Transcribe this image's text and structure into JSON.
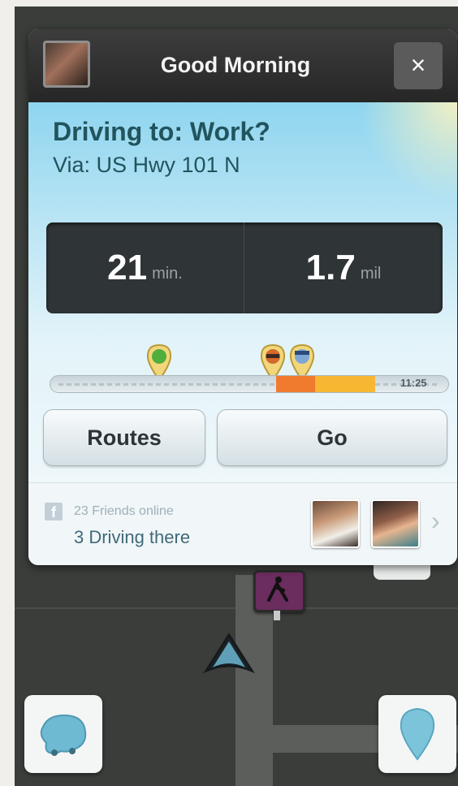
{
  "header": {
    "title": "Good Morning",
    "close_label": "×"
  },
  "destination": {
    "title": "Driving to: Work?",
    "via": "Via: US Hwy 101 N"
  },
  "stats": {
    "time_value": "21",
    "time_unit": "min.",
    "distance_value": "1.7",
    "distance_unit": "mil"
  },
  "timeline": {
    "end_time": "11:25"
  },
  "buttons": {
    "routes_label": "Routes",
    "go_label": "Go"
  },
  "footer": {
    "facebook_icon": "f",
    "friends_online": "23 Friends online",
    "driving_there": "3 Driving there",
    "chevron": "›"
  },
  "colors": {
    "header": "#2f2f2f",
    "title_text": "#22545e",
    "stats_bg": "#2f3437",
    "traffic_red": "#f07a2e",
    "traffic_yellow": "#f7b733",
    "map_bg": "#3a3d3a",
    "map_road": "#5b5e5b",
    "accent_blue": "#8ed5ef"
  },
  "icons": {
    "user_avatar": "user-avatar",
    "close": "close-icon",
    "pins": [
      "friend-pin-icon",
      "friend-pin-icon",
      "friend-pin-icon"
    ],
    "facebook": "facebook-icon",
    "map_left": "waze-menu-icon",
    "map_right": "report-pin-icon",
    "pedestrian": "pedestrian-crossing-icon",
    "car": "car-arrow-icon"
  }
}
